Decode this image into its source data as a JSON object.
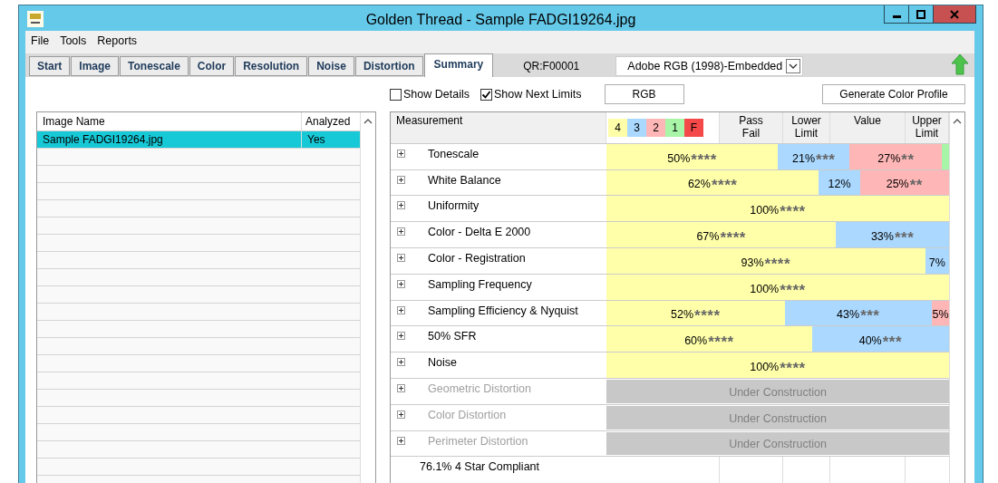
{
  "window": {
    "title": "Golden Thread  -  Sample FADGI19264.jpg"
  },
  "menu": [
    "File",
    "Tools",
    "Reports"
  ],
  "tabs": [
    {
      "label": "Start",
      "selected": false
    },
    {
      "label": "Image",
      "selected": false
    },
    {
      "label": "Tonescale",
      "selected": false
    },
    {
      "label": "Color",
      "selected": false
    },
    {
      "label": "Resolution",
      "selected": false
    },
    {
      "label": "Noise",
      "selected": false
    },
    {
      "label": "Distortion",
      "selected": false
    },
    {
      "label": "Summary",
      "selected": true
    }
  ],
  "qr_code": "QR:F00001",
  "profile_dropdown": {
    "value": "Adobe RGB (1998)-Embedded"
  },
  "options": [
    {
      "label": "Show Details",
      "checked": false
    },
    {
      "label": "Show Next Limits",
      "checked": true
    }
  ],
  "channel_button": "RGB",
  "generate_button": "Generate Color Profile",
  "image_list": {
    "columns": [
      "Image Name",
      "Analyzed"
    ],
    "rows": [
      {
        "cells": [
          "Sample FADGI19264.jpg",
          "Yes"
        ],
        "selected": true
      }
    ]
  },
  "summary": {
    "columns": [
      "Measurement",
      "Pass Fail",
      "Lower Limit",
      "Value",
      "Upper Limit"
    ],
    "legend": [
      {
        "label": "4",
        "color": "#ffffaa"
      },
      {
        "label": "3",
        "color": "#aad8ff"
      },
      {
        "label": "2",
        "color": "#ffb6b6"
      },
      {
        "label": "1",
        "color": "#a8f5a8"
      },
      {
        "label": "F",
        "color": "#f54848"
      }
    ],
    "rows": [
      {
        "name": "Tonescale",
        "expanded": false,
        "disabled": false,
        "segments": [
          {
            "text": "50%",
            "rating": "****",
            "color": "#ffffaa"
          },
          {
            "text": "21%",
            "rating": "***",
            "color": "#aad8ff"
          },
          {
            "text": "27%",
            "rating": "**",
            "color": "#ffb6b6"
          },
          {
            "color": "#a8f5a8"
          }
        ]
      },
      {
        "name": "White Balance",
        "expanded": false,
        "disabled": false,
        "segments": [
          {
            "text": "62%",
            "rating": "****",
            "color": "#ffffaa"
          },
          {
            "text": "12%",
            "color": "#aad8ff"
          },
          {
            "text": "25%",
            "rating": "**",
            "color": "#ffb6b6"
          }
        ]
      },
      {
        "name": "Uniformity",
        "expanded": false,
        "disabled": false,
        "segments": [
          {
            "text": "100%",
            "rating": "****",
            "color": "#ffffaa"
          }
        ]
      },
      {
        "name": "Color - Delta E 2000",
        "expanded": false,
        "disabled": false,
        "segments": [
          {
            "text": "67%",
            "rating": "****",
            "color": "#ffffaa"
          },
          {
            "text": "33%",
            "rating": "***",
            "color": "#aad8ff"
          }
        ]
      },
      {
        "name": "Color - Registration",
        "expanded": false,
        "disabled": false,
        "segments": [
          {
            "text": "93%",
            "rating": "****",
            "color": "#ffffaa"
          },
          {
            "text": "7%",
            "color": "#aad8ff"
          }
        ]
      },
      {
        "name": "Sampling Frequency",
        "expanded": false,
        "disabled": false,
        "segments": [
          {
            "text": "100%",
            "rating": "****",
            "color": "#ffffaa"
          }
        ]
      },
      {
        "name": "Sampling Efficiency & Nyquist",
        "expanded": false,
        "disabled": false,
        "segments": [
          {
            "text": "52%",
            "rating": "****",
            "color": "#ffffaa"
          },
          {
            "text": "43%",
            "rating": "***",
            "color": "#aad8ff"
          },
          {
            "text": "5%",
            "color": "#ffb6b6"
          }
        ]
      },
      {
        "name": "50% SFR",
        "expanded": false,
        "disabled": false,
        "segments": [
          {
            "text": "60%",
            "rating": "****",
            "color": "#ffffaa"
          },
          {
            "text": "40%",
            "rating": "***",
            "color": "#aad8ff"
          }
        ]
      },
      {
        "name": "Noise",
        "expanded": false,
        "disabled": false,
        "segments": [
          {
            "text": "100%",
            "rating": "****",
            "color": "#ffffaa"
          }
        ]
      },
      {
        "name": "Geometric Distortion",
        "expanded": false,
        "disabled": true,
        "status": "Under Construction"
      },
      {
        "name": "Color Distortion",
        "expanded": false,
        "disabled": true,
        "status": "Under Construction"
      },
      {
        "name": "Perimeter Distortion",
        "expanded": false,
        "disabled": true,
        "status": "Under Construction"
      }
    ],
    "footer": "76.1% 4 Star Compliant"
  }
}
